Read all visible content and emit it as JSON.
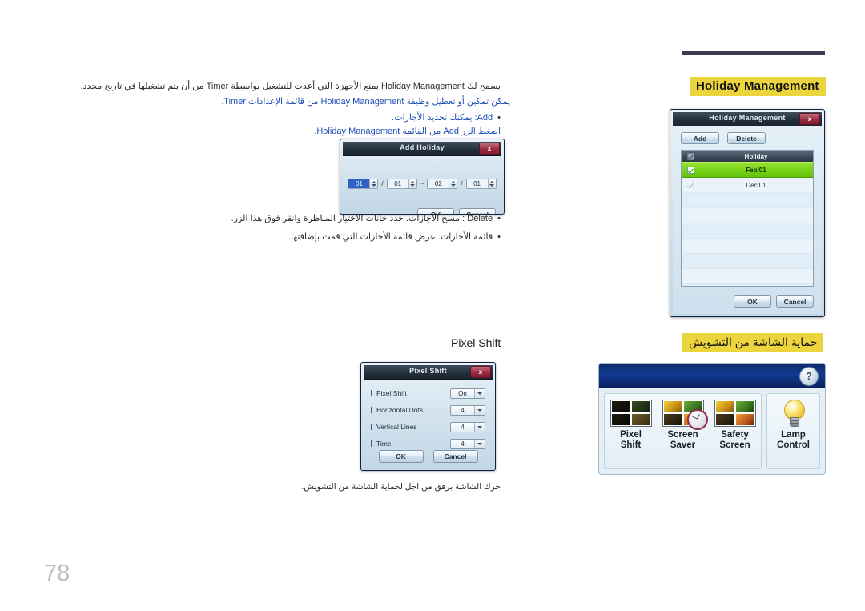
{
  "page": {
    "number": "78",
    "language": "ar"
  },
  "headings": {
    "holiday_management": "Holiday Management",
    "screen_protection": "حماية الشاشة من التشويش",
    "pixel_shift_label": "Pixel Shift"
  },
  "body": {
    "intro": "يسمح لك Holiday Management بمنع الأجهزة التي أعدت للتشغيل بواسطة Timer من أن يتم تشغيلها في تاريخ محدد.",
    "note": "يمكن تمكين أو تعطيل وظيفة Holiday Management من قائمة الإعدادات Timer.",
    "add_line": "Add: يمكنك تحديد الأجازات.",
    "add_sub": "اضغط الزر Add من القائمة Holiday Management.",
    "delete_line": "Delete : مسح الأجازات. حدد خانات الاختيار المناظرة وانقر فوق هذا الزر.",
    "list_line": "قائمة الأجازات: عرض قائمة الأجازات التي قمت بإضافتها.",
    "caption": "حرك الشاشة برفق من اجل لحماية الشاشة من التشويش."
  },
  "dialogs": {
    "add_holiday": {
      "title": "Add Holiday",
      "close_label": "x",
      "start_month": "01",
      "start_day": "01",
      "range_separator": "~",
      "end_month": "02",
      "end_day": "01",
      "ok_label": "OK",
      "cancel_label": "Cancel"
    },
    "holiday_management": {
      "title": "Holiday Management",
      "close_label": "x",
      "add_label": "Add",
      "delete_label": "Delete",
      "column_header": "Holiday",
      "rows": [
        {
          "checked": true,
          "label": "Feb/01",
          "selected": true
        },
        {
          "checked": true,
          "label": "Dec/01",
          "selected": false
        }
      ],
      "ok_label": "OK",
      "cancel_label": "Cancel"
    },
    "pixel_shift": {
      "title": "Pixel Shift",
      "close_label": "x",
      "rows": [
        {
          "label": "Pixel Shift",
          "value": "On"
        },
        {
          "label": "Horizontal Dots",
          "value": "4"
        },
        {
          "label": "Vertical Lines",
          "value": "4"
        },
        {
          "label": "Time",
          "value": "4"
        }
      ],
      "ok_label": "OK",
      "cancel_label": "Cancel"
    }
  },
  "screen_saver_panel": {
    "help_label": "?",
    "items": [
      {
        "line1": "Pixel",
        "line2": "Shift"
      },
      {
        "line1": "Screen",
        "line2": "Saver"
      },
      {
        "line1": "Safety",
        "line2": "Screen"
      },
      {
        "line1": "Lamp",
        "line2": "Control"
      }
    ]
  },
  "colors": {
    "highlight_yellow": "#ebd43c",
    "link_blue": "#1f4fb6",
    "rule": "#4a4a63",
    "selected_row_green": "#74d215",
    "osd_titlebar": "#24303c",
    "close_red": "#9d2a41"
  }
}
